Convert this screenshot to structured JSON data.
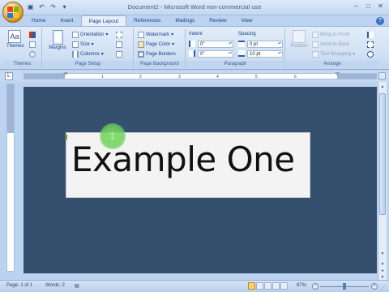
{
  "window": {
    "title": "Document2 - Microsoft Word non-commercial use",
    "minimize": "–",
    "maximize": "□",
    "close": "✕"
  },
  "tabs": [
    "Home",
    "Insert",
    "Page Layout",
    "References",
    "Mailings",
    "Review",
    "View"
  ],
  "active_tab": "Page Layout",
  "ribbon": {
    "themes": {
      "label": "Themes",
      "group": "Themes"
    },
    "page_setup": {
      "group": "Page Setup",
      "margins": "Margins",
      "orientation": "Orientation",
      "size": "Size",
      "columns": "Columns"
    },
    "page_background": {
      "group": "Page Background",
      "watermark": "Watermark",
      "page_color": "Page Color",
      "page_borders": "Page Borders"
    },
    "paragraph": {
      "group": "Paragraph",
      "indent": "Indent",
      "indent_left": "0\"",
      "indent_right": "0\"",
      "spacing": "Spacing",
      "spacing_before": "0 pt",
      "spacing_after": "10 pt"
    },
    "arrange": {
      "group": "Arrange",
      "position": "Position",
      "bring_to_front": "Bring to Front",
      "send_to_back": "Send to Back",
      "text_wrapping": "Text Wrapping"
    }
  },
  "ruler": {
    "ticks": [
      "1",
      "2",
      "3",
      "4",
      "5",
      "6"
    ]
  },
  "document": {
    "text": "Example One"
  },
  "status": {
    "page": "Page: 1 of 1",
    "words": "Words: 2",
    "zoom": "87%"
  },
  "colors": {
    "doc_background": "#35506f",
    "ribbon": "#cfdff3",
    "accent": "#15428b"
  }
}
